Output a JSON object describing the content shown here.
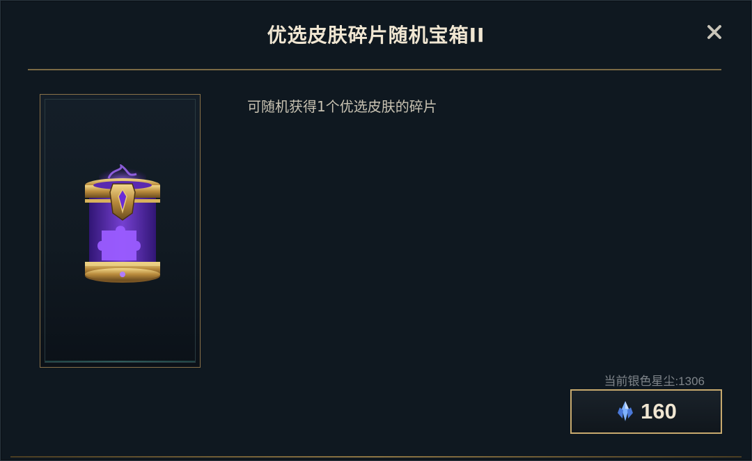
{
  "dialog": {
    "title": "优选皮肤碎片随机宝箱II",
    "close_icon": "close-icon",
    "description": "可随机获得1个优选皮肤的碎片",
    "item_icon": "skin-shard-chest-icon",
    "currency": {
      "label": "当前银色星尘:1306",
      "icon": "silver-stardust-icon"
    },
    "buy_button": {
      "price": "160"
    }
  },
  "colors": {
    "gold": "#c8aa6e",
    "title_text": "#f0e6d2",
    "background": "#0f1820",
    "purple": "#7a3de0"
  }
}
